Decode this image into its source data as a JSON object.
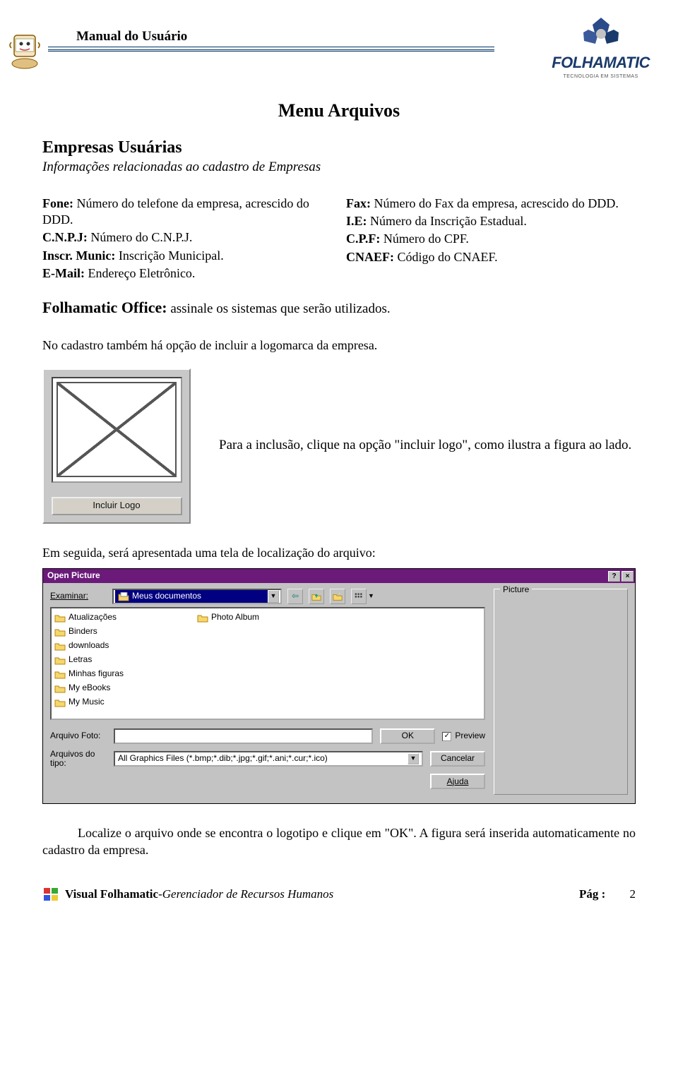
{
  "header": {
    "manual_title": "Manual do Usuário",
    "brand_name": "FOLHAMATIC",
    "brand_tag": "TECNOLOGIA EM SISTEMAS"
  },
  "menu_title": "Menu Arquivos",
  "section": {
    "title": "Empresas Usuárias",
    "subtitle": "Informações relacionadas ao cadastro de Empresas"
  },
  "fields_left": [
    {
      "label": "Fone:",
      "desc": " Número do telefone da empresa, acrescido do DDD."
    },
    {
      "label": "C.N.P.J:",
      "desc": " Número do C.N.P.J."
    },
    {
      "label": "Inscr. Munic:",
      "desc": " Inscrição Municipal."
    },
    {
      "label": "E-Mail:",
      "desc": " Endereço Eletrônico."
    }
  ],
  "fields_right": [
    {
      "label": "Fax:",
      "desc": " Número do Fax da empresa, acrescido do DDD."
    },
    {
      "label": "I.E:",
      "desc": " Número da Inscrição Estadual."
    },
    {
      "label": "C.P.F:",
      "desc": " Número do CPF."
    },
    {
      "label": "CNAEF:",
      "desc": " Código do CNAEF."
    }
  ],
  "folhamatic_office": {
    "label": "Folhamatic Office:",
    "desc": " assinale os sistemas que serão utilizados."
  },
  "para1": "No cadastro também há opção de incluir a logomarca da empresa.",
  "logo_panel": {
    "button_label": "Incluir Logo",
    "caption": "Para a inclusão, clique na opção \"incluir logo\", como ilustra a figura ao lado."
  },
  "para2": "Em seguida, será apresentada uma tela de localização do arquivo:",
  "dialog": {
    "title": "Open Picture",
    "help": "?",
    "close": "×",
    "examine_label": "Examinar:",
    "examine_value": "Meus documentos",
    "folders": [
      "Atualizações",
      "Binders",
      "downloads",
      "Letras",
      "Minhas figuras",
      "My eBooks",
      "My Music",
      "Photo Album"
    ],
    "arquivo_foto_label": "Arquivo Foto:",
    "arquivo_foto_value": "",
    "arquivos_tipo_label": "Arquivos do tipo:",
    "arquivos_tipo_value": "All Graphics Files (*.bmp;*.dib;*.jpg;*.gif;*.ani;*.cur;*.ico)",
    "ok": "OK",
    "cancel": "Cancelar",
    "help_btn": "Ajuda",
    "picture_group": "Picture",
    "preview_label": "Preview"
  },
  "para3": "Localize o arquivo onde se encontra o logotipo e clique em \"OK\". A figura será inserida automaticamente no cadastro da empresa.",
  "footer": {
    "product": "Visual Folhamatic",
    "dash": " - ",
    "subtitle": "Gerenciador de Recursos Humanos",
    "page_label": "Pág :",
    "page_num": "2"
  }
}
